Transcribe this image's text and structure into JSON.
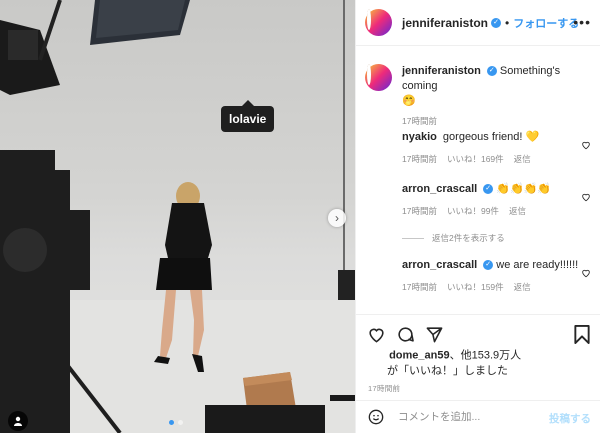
{
  "photo": {
    "tag_label": "lolavie",
    "carousel": {
      "slide_count": 2,
      "active_index": 0
    }
  },
  "post": {
    "author": "jenniferaniston",
    "follow_label": "フォローする",
    "separator": "•",
    "more_label": "•••"
  },
  "caption": {
    "user": "jenniferaniston",
    "text": "Something's coming",
    "emoji": "🤭",
    "time": "17時間前"
  },
  "comments": [
    {
      "user": "nyakio",
      "verified": false,
      "text": "gorgeous friend! 💛",
      "time": "17時間前",
      "likes": "いいね！169件",
      "reply": "返信"
    },
    {
      "user": "arron_crascall",
      "verified": true,
      "text": "👏👏👏👏",
      "time": "17時間前",
      "likes": "いいね！99件",
      "reply": "返信"
    },
    {
      "user": "arron_crascall",
      "verified": true,
      "text": "we are ready!!!!!!",
      "time": "17時間前",
      "likes": "いいね！159件",
      "reply": "返信"
    }
  ],
  "view_replies_label": "返信2件を表示する",
  "likes": {
    "name": "dome_an59",
    "rest": "、他153.9万人",
    "line2": "が「いいね！」しました"
  },
  "timestamp": "17時間前",
  "add_comment": {
    "placeholder": "コメントを追加...",
    "post_label": "投稿する"
  },
  "colors": {
    "accent": "#3897f0",
    "text": "#262626",
    "muted": "#8e8e8e"
  }
}
